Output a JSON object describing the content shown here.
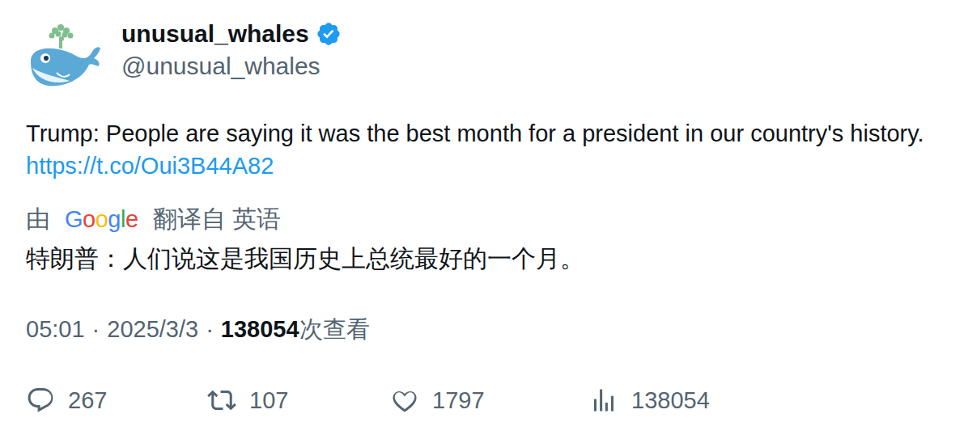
{
  "author": {
    "name": "unusual_whales",
    "handle": "@unusual_whales",
    "verified": true
  },
  "tweet": {
    "text": "Trump: People are saying it was the best month for a president in our country's history.",
    "link": "https://t.co/Oui3B44A82"
  },
  "translation": {
    "prefix": "由",
    "provider": [
      {
        "char": "G",
        "color": "#4285F4"
      },
      {
        "char": "o",
        "color": "#EA4335"
      },
      {
        "char": "o",
        "color": "#FBBC05"
      },
      {
        "char": "g",
        "color": "#4285F4"
      },
      {
        "char": "l",
        "color": "#34A853"
      },
      {
        "char": "e",
        "color": "#EA4335"
      }
    ],
    "suffix": "翻译自 英语",
    "text": "特朗普：人们说这是我国历史上总统最好的一个月。"
  },
  "meta": {
    "time": "05:01",
    "separator": "·",
    "date": "2025/3/3",
    "views": "138054",
    "views_label": "次查看"
  },
  "actions": [
    {
      "kind": "reply",
      "count": "267"
    },
    {
      "kind": "retweet",
      "count": "107"
    },
    {
      "kind": "like",
      "count": "1797"
    },
    {
      "kind": "views",
      "count": "138054"
    }
  ]
}
